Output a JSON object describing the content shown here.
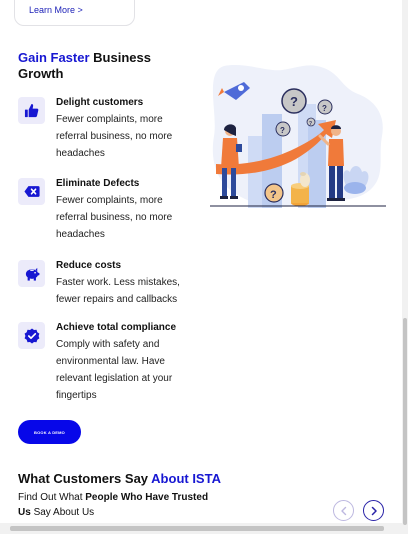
{
  "learn_more": {
    "label": "Learn More >"
  },
  "section": {
    "title_accent": "Gain Faster",
    "title_rest": " Business Growth"
  },
  "features": [
    {
      "title": "Delight customers",
      "description": "Fewer complaints, more referral business, no more headaches",
      "icon": "thumbs-up-icon"
    },
    {
      "title": "Eliminate Defects",
      "description": "Fewer complaints, more referral business, no more headaches",
      "icon": "backspace-x-icon"
    },
    {
      "title": "Reduce costs",
      "description": "Faster work. Less mistakes, fewer repairs and callbacks",
      "icon": "piggy-bank-icon"
    },
    {
      "title": "Achieve total compliance",
      "description": "Comply with safety and environmental law. Have relevant legislation at your fingertips",
      "icon": "check-badge-icon"
    }
  ],
  "demo_button": {
    "label": "BOOK A DEMO"
  },
  "customers": {
    "title_main": "What Customers Say ",
    "title_accent": "About ISTA",
    "sub_part1": "Find Out What ",
    "sub_bold1": "People Who Have Trusted Us",
    "sub_part2": " Say About Us"
  },
  "colors": {
    "accent": "#1717d2",
    "button": "#0707e9",
    "icon_bg": "#ecebfa",
    "illustration_orange": "#f07a3a"
  }
}
